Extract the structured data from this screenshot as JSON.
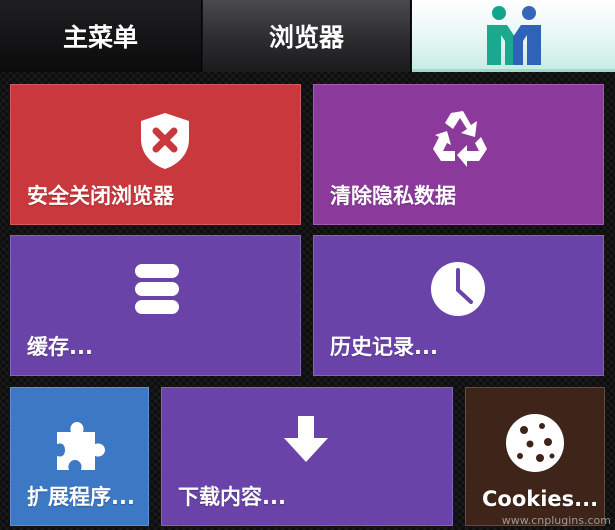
{
  "tabs": {
    "main_menu": "主菜单",
    "browser": "浏览器",
    "logo_icon": "maxthon-logo-icon"
  },
  "tiles": [
    {
      "id": "safe-exit",
      "label": "安全关闭浏览器",
      "icon": "shield-x-icon",
      "color": "#c8383d"
    },
    {
      "id": "clear-private-data",
      "label": "清除隐私数据",
      "icon": "recycle-icon",
      "color": "#8b3a9c"
    },
    {
      "id": "cache",
      "label": "缓存...",
      "icon": "database-icon",
      "color": "#6a43a8"
    },
    {
      "id": "history",
      "label": "历史记录...",
      "icon": "clock-icon",
      "color": "#6a43a8"
    },
    {
      "id": "extensions",
      "label": "扩展程序...",
      "icon": "puzzle-icon",
      "color": "#3d78c5"
    },
    {
      "id": "downloads",
      "label": "下载内容...",
      "icon": "download-arrow-icon",
      "color": "#6a43a8"
    },
    {
      "id": "cookies",
      "label": "Cookies...",
      "icon": "cookie-icon",
      "color": "#3f2419"
    }
  ],
  "watermark": "www.cnplugins.com"
}
